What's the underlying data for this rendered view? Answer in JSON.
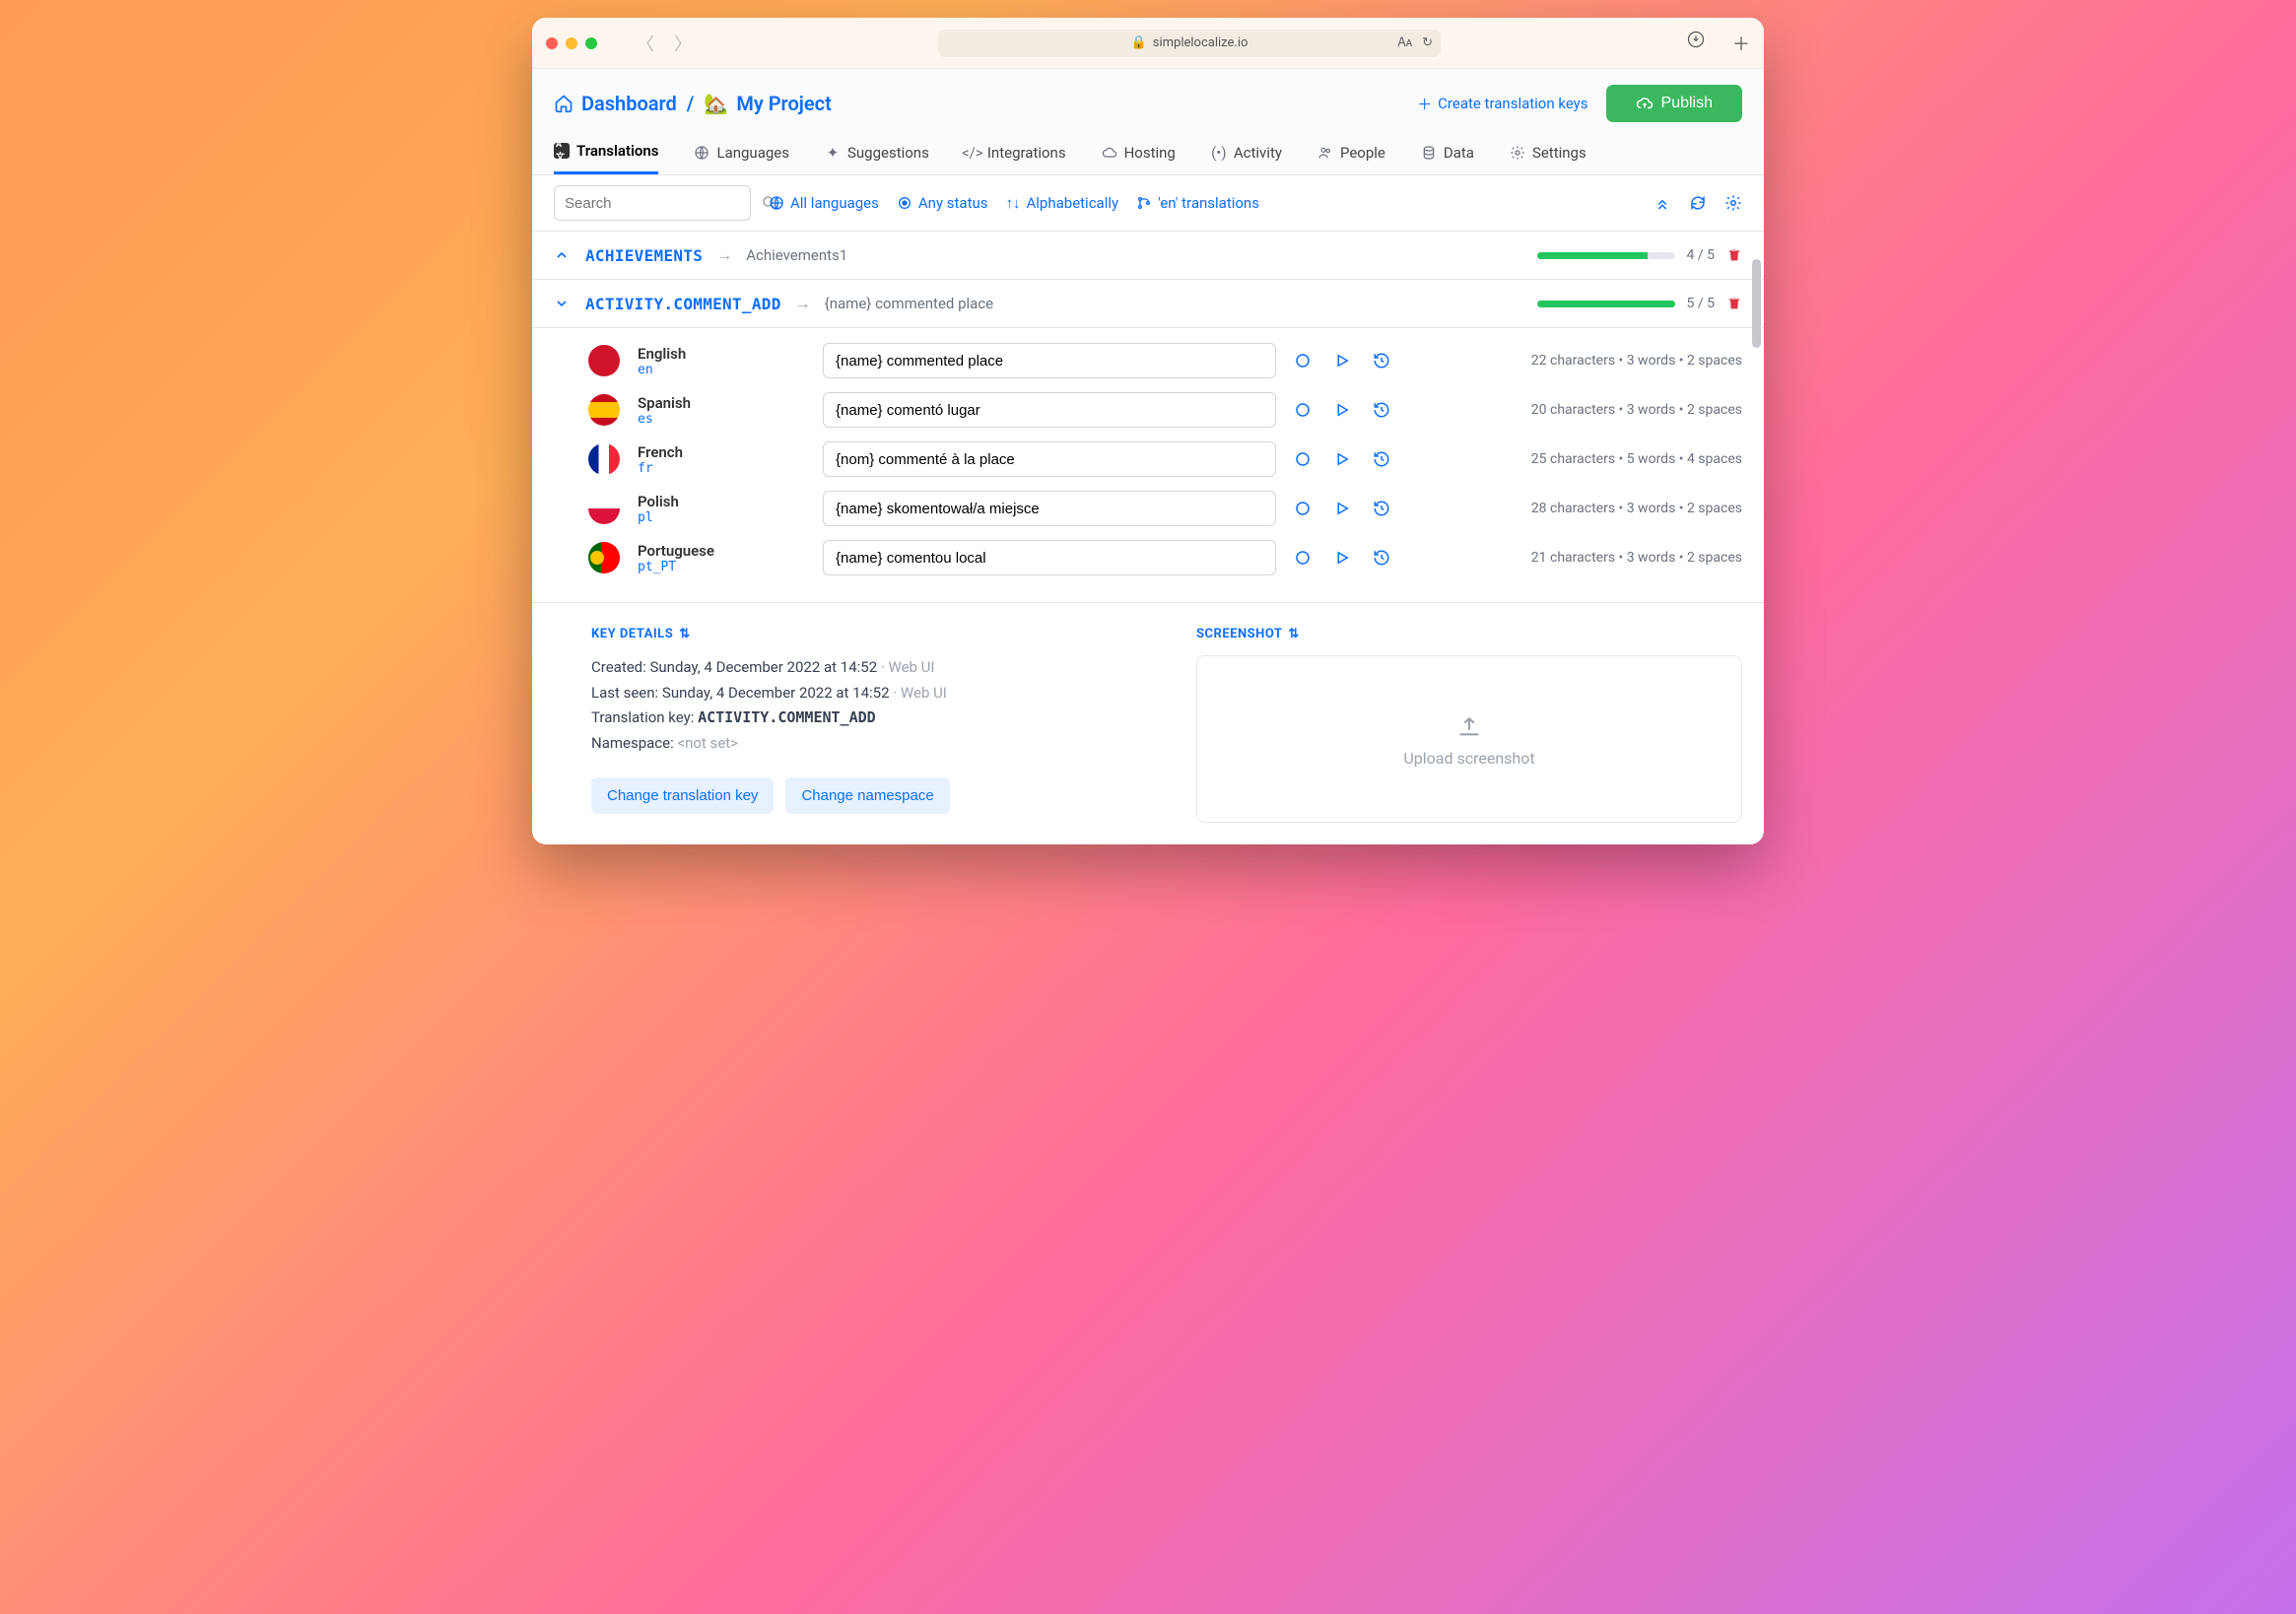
{
  "titlebar": {
    "url": "simplelocalize.io"
  },
  "breadcrumb": {
    "dashboard": "Dashboard",
    "project": "My Project"
  },
  "actions": {
    "create": "Create translation keys",
    "publish": "Publish"
  },
  "tabs": [
    {
      "icon": "az",
      "label": "Translations"
    },
    {
      "icon": "globe",
      "label": "Languages"
    },
    {
      "icon": "sparkle",
      "label": "Suggestions"
    },
    {
      "icon": "code",
      "label": "Integrations"
    },
    {
      "icon": "cloud",
      "label": "Hosting"
    },
    {
      "icon": "signal",
      "label": "Activity"
    },
    {
      "icon": "people",
      "label": "People"
    },
    {
      "icon": "db",
      "label": "Data"
    },
    {
      "icon": "gear",
      "label": "Settings"
    }
  ],
  "filters": {
    "search_placeholder": "Search",
    "all_languages": "All languages",
    "any_status": "Any status",
    "sort": "Alphabetically",
    "source": "'en' translations"
  },
  "keys": [
    {
      "name": "ACHIEVEMENTS",
      "preview": "Achievements1",
      "progress": "4 / 5",
      "pct": 80,
      "expanded": false
    },
    {
      "name": "ACTIVITY.COMMENT_ADD",
      "preview": "{name} commented place",
      "progress": "5 / 5",
      "pct": 100,
      "expanded": true
    }
  ],
  "translations": [
    {
      "flag": "en",
      "lang": "English",
      "code": "en",
      "value": "{name} commented place",
      "stats": "22 characters  •  3 words  •  2 spaces"
    },
    {
      "flag": "es",
      "lang": "Spanish",
      "code": "es",
      "value": "{name} comentó lugar",
      "stats": "20 characters  •  3 words  •  2 spaces"
    },
    {
      "flag": "fr",
      "lang": "French",
      "code": "fr",
      "value": "{nom} commenté à la place",
      "stats": "25 characters  •  5 words  •  4 spaces"
    },
    {
      "flag": "pl",
      "lang": "Polish",
      "code": "pl",
      "value": "{name} skomentował/a miejsce",
      "stats": "28 characters  •  3 words  •  2 spaces"
    },
    {
      "flag": "pt",
      "lang": "Portuguese",
      "code": "pt_PT",
      "value": "{name} comentou local",
      "stats": "21 characters  •  3 words  •  2 spaces"
    }
  ],
  "details": {
    "heading": "KEY DETAILS",
    "created_label": "Created: ",
    "created_value": "Sunday, 4 December 2022 at 14:52",
    "created_src": "Web UI",
    "seen_label": "Last seen: ",
    "seen_value": "Sunday, 4 December 2022 at 14:52",
    "seen_src": "Web UI",
    "tk_label": "Translation key: ",
    "tk_value": "ACTIVITY.COMMENT_ADD",
    "ns_label": "Namespace: ",
    "ns_value": "<not set>",
    "btn_key": "Change translation key",
    "btn_ns": "Change namespace"
  },
  "screenshot": {
    "heading": "SCREENSHOT",
    "placeholder": "Upload screenshot"
  }
}
